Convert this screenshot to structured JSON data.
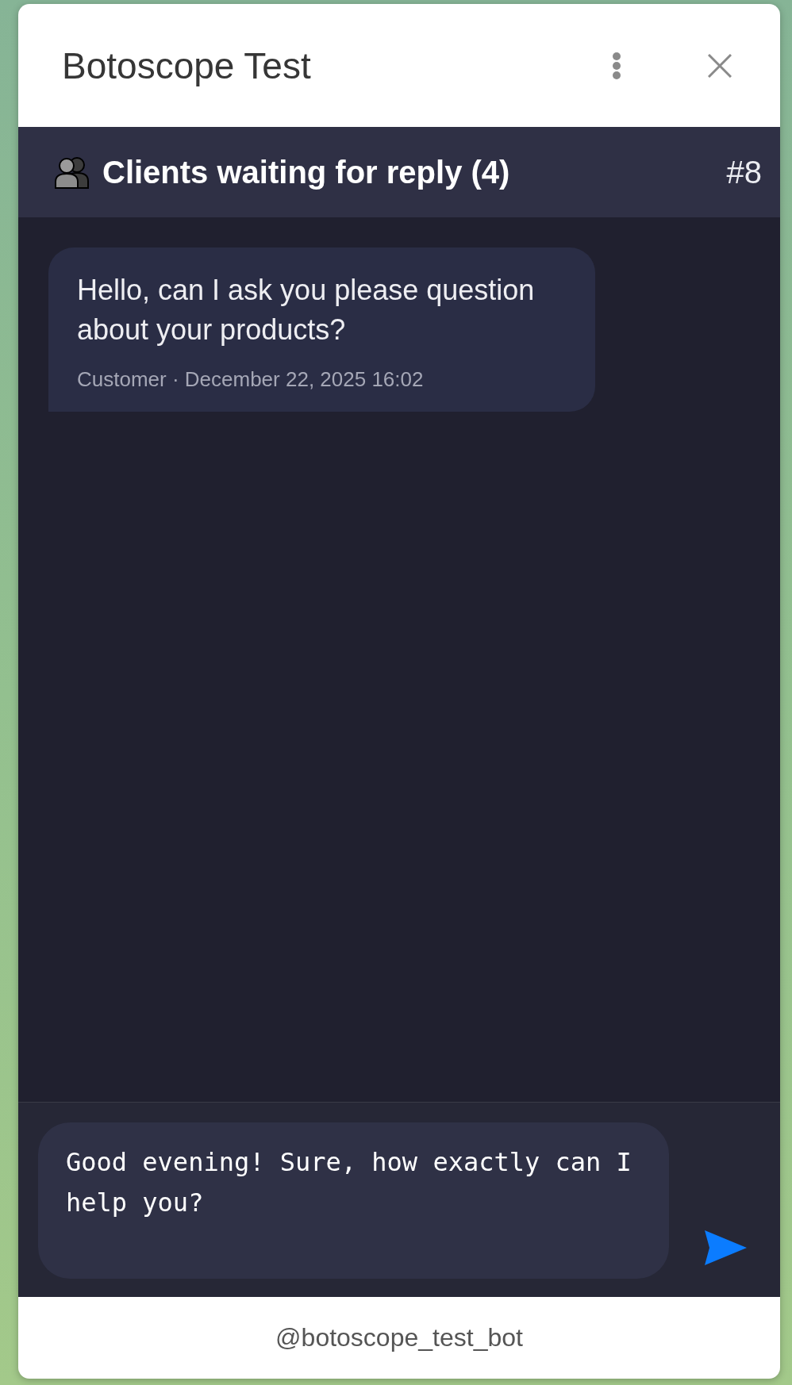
{
  "window": {
    "title": "Botoscope Test"
  },
  "queue_bar": {
    "title": "Clients waiting for reply (4)",
    "ticket": "#8"
  },
  "messages": [
    {
      "text": "Hello, can I ask you please question about your products?",
      "meta": "Customer · December 22, 2025 16:02"
    }
  ],
  "composer": {
    "value": "Good evening! Sure, how exactly can I help you?"
  },
  "footer": {
    "username": "@botoscope_test_bot"
  }
}
